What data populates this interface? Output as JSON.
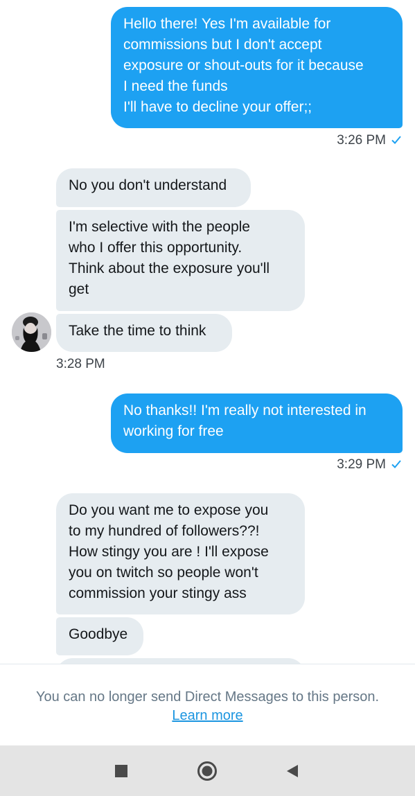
{
  "messages": [
    {
      "text": "Hello there! Yes I'm available for\ncommissions but I don't accept\nexposure or shout-outs for it because\nI need the funds\nI'll have to decline your offer;;"
    },
    {
      "text": "No you don't understand"
    },
    {
      "text": "I'm selective with the people\nwho I offer this opportunity.\nThink about the exposure you'll\nget"
    },
    {
      "text": "Take the time to think"
    },
    {
      "text": "No thanks!! I'm really not interested in\nworking for free"
    },
    {
      "text": "Do you want me to expose you\nto my hundred of followers??!\nHow stingy you are ! I'll expose\nyou on twitch so people won't\ncommission your stingy ass"
    },
    {
      "text": "Goodbye"
    }
  ],
  "timestamps": {
    "t1": "3:26 PM",
    "t2": "3:28 PM",
    "t3": "3:29 PM"
  },
  "footer": {
    "notice": "You can no longer send Direct Messages to this person.",
    "learn_more": "Learn more"
  },
  "colors": {
    "sent_bubble": "#1da1f2",
    "received_bubble": "#e6ecf0",
    "link": "#1b95e0",
    "nav_bar": "#e4e4e4"
  },
  "icons": {
    "read_receipt": "check-icon",
    "nav_recents": "square-icon",
    "nav_home": "circle-icon",
    "nav_back": "triangle-back-icon"
  }
}
